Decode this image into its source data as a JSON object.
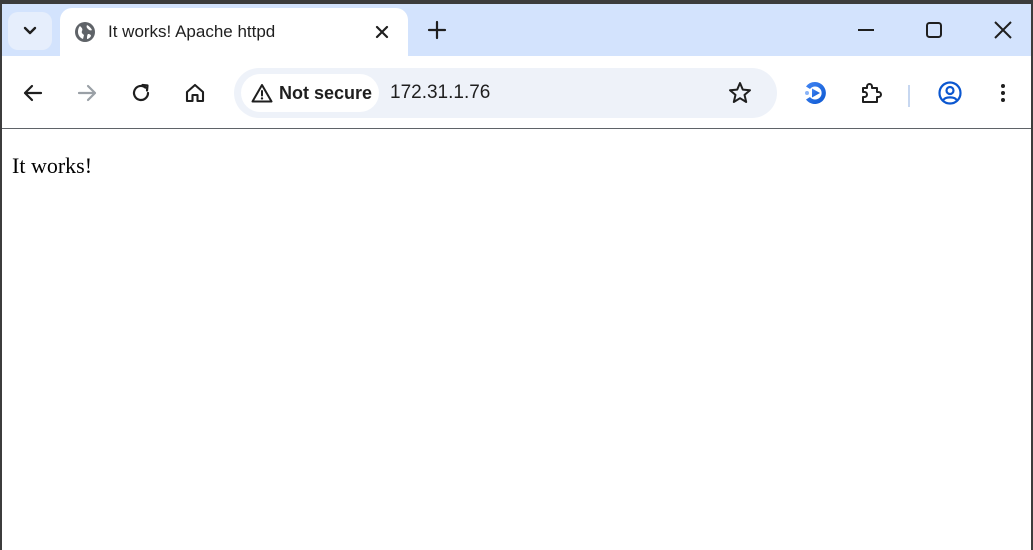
{
  "tab": {
    "title": "It works! Apache httpd"
  },
  "omnibox": {
    "security_label": "Not secure",
    "url": "172.31.1.76"
  },
  "page": {
    "heading": "It works!"
  },
  "icons": {
    "tab_search": "chevron-down-icon",
    "favicon": "globe-icon",
    "tab_close": "close-icon",
    "new_tab": "plus-icon",
    "minimize": "minimize-icon",
    "maximize": "maximize-icon",
    "close_window": "close-icon",
    "back": "arrow-left-icon",
    "forward": "arrow-right-icon",
    "reload": "reload-icon",
    "home": "home-icon",
    "not_secure": "warning-triangle-icon",
    "bookmark": "star-icon",
    "media_extension": "media-play-icon",
    "extensions": "puzzle-icon",
    "profile": "person-circle-icon",
    "menu": "kebab-menu-icon"
  },
  "colors": {
    "tabstrip_bg": "#d3e3fd",
    "omnibox_bg": "#eef2f9",
    "icon": "#1f1f1f",
    "disabled_icon": "#9aa0a6",
    "accent_blue": "#0b57d0"
  }
}
